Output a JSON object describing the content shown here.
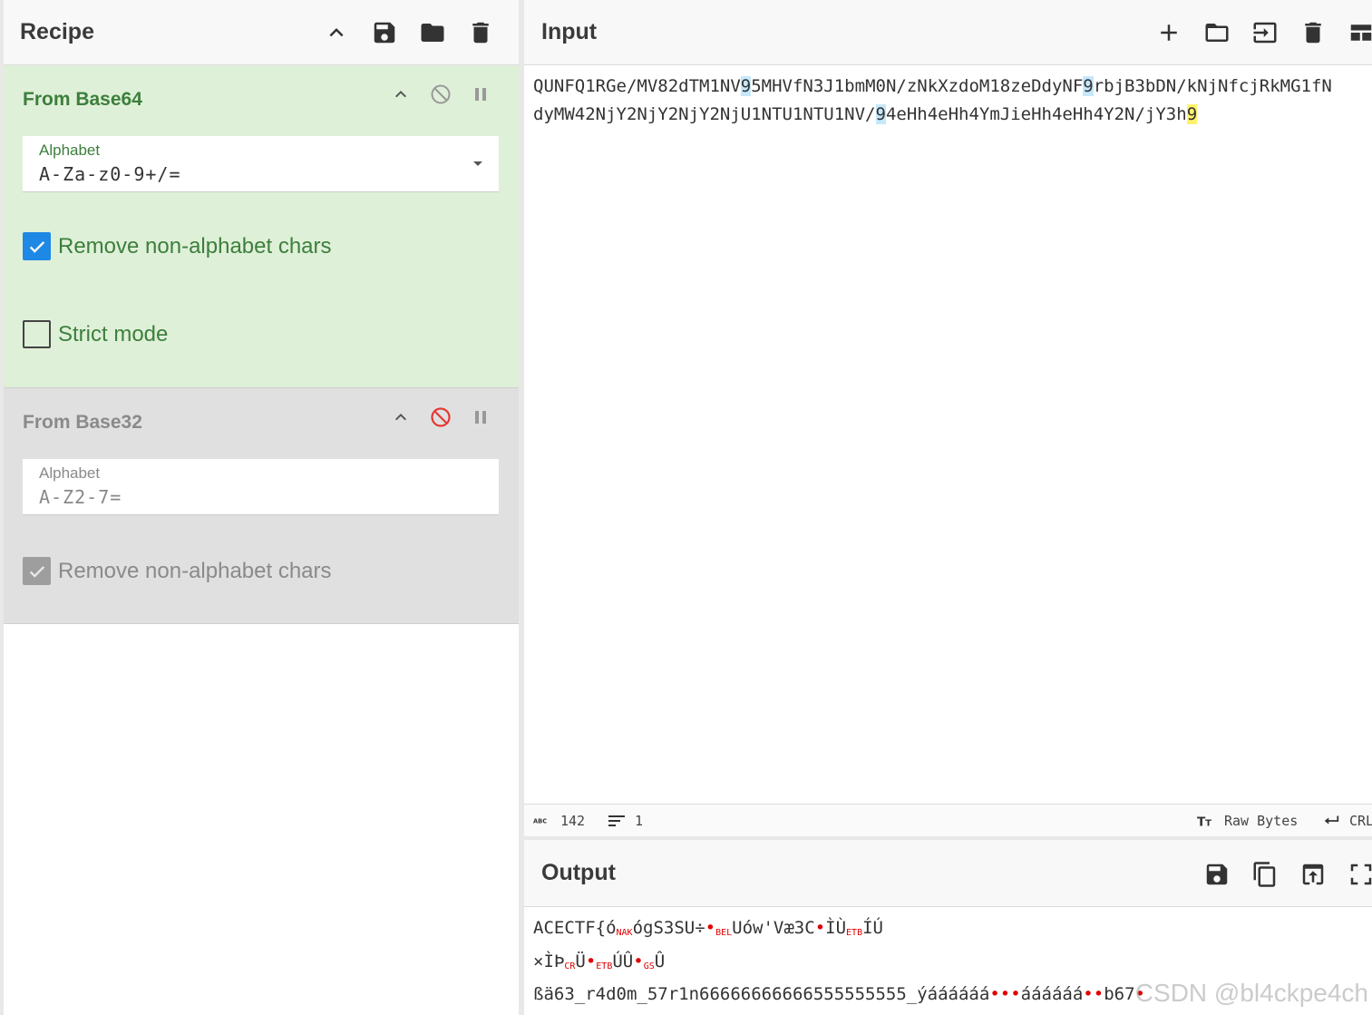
{
  "recipe": {
    "title": "Recipe",
    "operations": [
      {
        "name": "From Base64",
        "alphabet_label": "Alphabet",
        "alphabet_value": "A-Za-z0-9+/=",
        "options": [
          {
            "label": "Remove non-alphabet chars",
            "checked": true
          },
          {
            "label": "Strict mode",
            "checked": false
          }
        ],
        "state": "enabled"
      },
      {
        "name": "From Base32",
        "alphabet_label": "Alphabet",
        "alphabet_value": "A-Z2-7=",
        "options": [
          {
            "label": "Remove non-alphabet chars",
            "checked": true
          }
        ],
        "state": "disabled"
      }
    ],
    "header_icons": [
      "chevron-up-icon",
      "save-icon",
      "folder-icon",
      "trash-icon"
    ]
  },
  "input": {
    "title": "Input",
    "line1": {
      "a": "QUNFQ1RGe/MV82dTM1NV",
      "b": "9",
      "c": "5MHVfN3J1bmM0N/zNkXzdoM18zeDdyNF",
      "d": "9",
      "e": "rbjB3bDN/kNjNfcjRkMG1fN"
    },
    "line2": {
      "a": "dyMW42NjY2NjY2NjY2NjU1NTU1NTU1NV/",
      "b": "9",
      "c": "4eHh4eHh4YmJieHh4eHh4Y2N/jY3h",
      "d": "9"
    },
    "status": {
      "chars_icon": "abc-icon",
      "chars": "142",
      "lines_icon": "lines-icon",
      "lines": "1",
      "format_icon": "text-format-icon",
      "format": "Raw Bytes",
      "eol_icon": "return-icon",
      "eol": "CRL"
    },
    "header_icons": [
      "plus-icon",
      "folder-icon",
      "import-icon",
      "trash-icon",
      "layout-icon"
    ]
  },
  "output": {
    "title": "Output",
    "line1": {
      "a": "ACECTF{ó",
      "cc1": "NAK",
      "b": "ógS3SU÷",
      "dot1": "•",
      "cc2": "BEL",
      "c": "Uów'Væ3C",
      "dot2": "•",
      "d": "ÌÙ",
      "cc3": "ETB",
      "e": "ÍÚ"
    },
    "line2": {
      "a": "×ÌÞ",
      "cc1": "CR",
      "b": "Ü",
      "dot1": "•",
      "cc2": "ETB",
      "c": "ÚÛ",
      "dot2": "•",
      "cc3": "GS",
      "d": "Û"
    },
    "line3": {
      "a": "ßä63_r4d0m_57r1n66666666666555555555_ýáááááá",
      "dots1": "•••",
      "b": "áááááá",
      "dots2": "••",
      "c": "b67",
      "dot3": "•"
    },
    "watermark": "CSDN @bl4ckpe4ch",
    "header_icons": [
      "save-icon",
      "copy-icon",
      "replace-input-icon",
      "maximize-icon"
    ]
  },
  "colors": {
    "enabled_op_bg": "#dff0d8",
    "enabled_op_text": "#3c7f3c",
    "disabled_op_bg": "#e0e0e0",
    "checkbox_blue": "#1e88e5",
    "highlight_blue": "#c5e8fb",
    "highlight_yellow": "#fff36b",
    "control_char_red": "#e00000"
  }
}
